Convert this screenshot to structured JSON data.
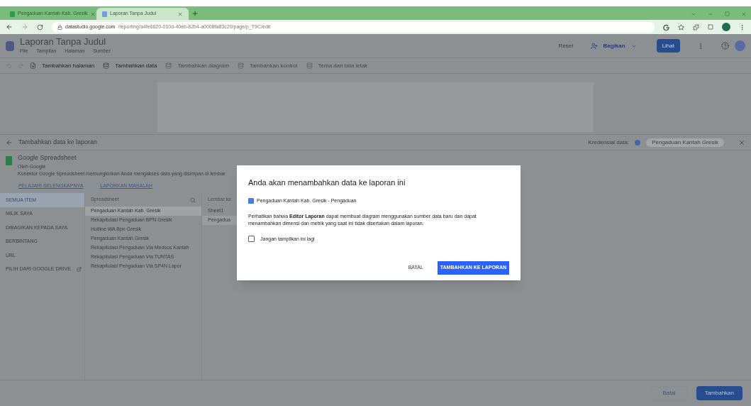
{
  "browser": {
    "tabs": [
      {
        "title": "Pengaduan Kantah Kab. Gresik",
        "selected": false
      },
      {
        "title": "Laporan Tanpa Judul",
        "selected": true
      }
    ],
    "url_host": "datastudio.google.com",
    "url_path": "/reporting/a4fe6620-010d-40eb-82b4-a0008fa83c20/page/p_T9C/edit"
  },
  "app": {
    "title": "Laporan Tanpa Judul",
    "menus": [
      "File",
      "Tampilan",
      "Halaman",
      "Sumber"
    ],
    "reset": "Reset",
    "share": "Bagikan",
    "view": "Lihat",
    "toolbar": [
      {
        "label": "Tambahkan halaman",
        "disabled": false
      },
      {
        "label": "Tambahkan data",
        "disabled": false
      },
      {
        "label": "Tambahkan diagram",
        "disabled": true
      },
      {
        "label": "Tambahkan kontrol",
        "disabled": true
      },
      {
        "label": "Tema dan tata letak",
        "disabled": true
      }
    ]
  },
  "panel": {
    "title": "Tambahkan data ke laporan",
    "credential_label": "Kredensial data:",
    "credential": "Pengaduan Kantah Gresik",
    "connector": {
      "name": "Google Spreadsheet",
      "by": "Oleh Google",
      "description": "Konektor Google Spreadsheet memungkinkan Anda mengakses data yang disimpan di lembar",
      "links": [
        "PELAJARI SELENGKAPNYA",
        "LAPORKAN MASALAH"
      ]
    },
    "locations": [
      {
        "label": "SEMUA ITEM",
        "selected": true
      },
      {
        "label": "MILIK SAYA",
        "selected": false
      },
      {
        "label": "DIBAGIKAN KEPADA SAYA",
        "selected": false
      },
      {
        "label": "BERBINTANG",
        "selected": false
      },
      {
        "label": "URL",
        "selected": false
      },
      {
        "label": "PILIH DARI GOOGLE DRIVE",
        "selected": false
      }
    ],
    "search": {
      "placeholder": "Spreadsheet"
    },
    "spreadsheets": [
      {
        "name": "Pengaduan Kantah Kab. Gresik",
        "selected": true
      },
      {
        "name": "Rekapitulasi Pengaduan BPN Gresik",
        "selected": false
      },
      {
        "name": "Hotline WA Bpn Gresik",
        "selected": false
      },
      {
        "name": "Pengaduan Kantah Gresik",
        "selected": false
      },
      {
        "name": "Rekapitulasi Pengaduan Via Medsos Kantah",
        "selected": false
      },
      {
        "name": "Rekapitulasi Pengaduan Via TUNTAS",
        "selected": false
      },
      {
        "name": "Rekapitulasi Pengaduan Via SP4N Lapor",
        "selected": false
      }
    ],
    "sheets_header": "Lembar ke",
    "sheets": [
      {
        "name": "Sheet1",
        "selected": false
      },
      {
        "name": "Pengadua",
        "selected": true
      }
    ],
    "buttons": [
      "Batal",
      "Tambahkan"
    ]
  },
  "dialog": {
    "title": "Anda akan menambahkan data ke laporan ini",
    "source": "Pengaduan Kantah Kab. Gresik - Pengaduan",
    "note": "Perhatikan bahwa **Editor Laporan** dapat membuat diagram menggunakan sumber data baru dan dapat menambahkan dimensi dan metrik yang saat ini tidak disertakan dalam laporan.",
    "checkbox": {
      "label": "Jangan tampilkan ini lagi",
      "checked": false
    },
    "cancel": "BATAL",
    "confirm": "TAMBAHKAN KE LAPORAN"
  }
}
